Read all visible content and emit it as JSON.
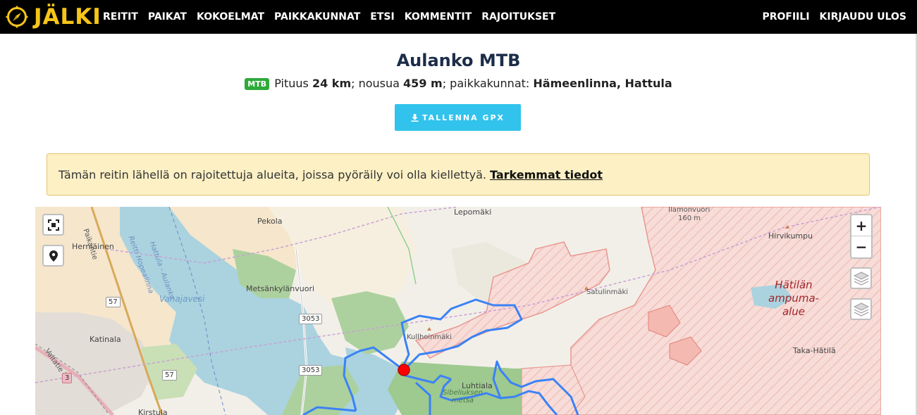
{
  "navbar": {
    "brand": "JÄLKI",
    "left_links": [
      "REITIT",
      "PAIKAT",
      "KOKOELMAT",
      "PAIKKAKUNNAT",
      "ETSI",
      "KOMMENTIT",
      "RAJOITUKSET"
    ],
    "right_links": [
      "PROFIILI",
      "KIRJAUDU ULOS"
    ],
    "colors": {
      "background": "#000000",
      "brand": "#f5c518",
      "link": "#ffffff"
    }
  },
  "route": {
    "title": "Aulanko MTB",
    "badge": "MTB",
    "length_label": "Pituus",
    "length_value": "24 km",
    "ascent_label": "; nousua",
    "ascent_value": "459 m",
    "places_label": "; paikkakunnat:",
    "places_value": "Hämeenlinna, Hattula"
  },
  "gpx_button": {
    "label": "TALLENNA GPX",
    "icon": "download-icon",
    "color": "#31c3ec"
  },
  "alert": {
    "text": "Tämän reitin lähellä on rajoitettuja alueita, joissa pyöräily voi olla kiellettyä.",
    "link_text": "Tarkemmat tiedot",
    "background": "#fcf0c4"
  },
  "map": {
    "controls": {
      "fullscreen_icon": "fullscreen-icon",
      "locate_icon": "location-pin-icon",
      "zoom_in": "+",
      "zoom_out": "−",
      "layers_icon": "layers-icon"
    },
    "labels": {
      "lepomaki": "Lepomäki",
      "ilamonvuori": "Ilamonvuori",
      "ilamonvuori_elev": "160 m",
      "hirvikumpu": "Hirvikumpu",
      "pekola": "Pekola",
      "herniainen": "Herniäinen",
      "metsankylanvuori": "Metsänkylänvuori",
      "vanajavesi": "Vanajavesi",
      "satulinmaki": "Satulinmäki",
      "hatilan_ampuma_alue_1": "Hätilän",
      "hatilan_ampuma_alue_2": "ampuma-",
      "hatilan_ampuma_alue_3": "alue",
      "kullhoinmaki": "Kullhoinmäki",
      "katinala": "Katinala",
      "taka_hatila": "Taka-Hätilä",
      "luhtiala": "Luhtiala",
      "sibeliuksen_metsa_1": "Sibeliuksen",
      "sibeliuksen_metsa_2": "metsä",
      "kirstula": "Kirstula",
      "reitti_hopealinna": "Reitti Hopealinna",
      "hattula_aulanko": "Hattula - Aulanko",
      "paikantie": "Paikantie",
      "valtatie_3": "Valtatie 3"
    },
    "road_shields": [
      "57",
      "3053",
      "3053",
      "57",
      "3"
    ],
    "colors": {
      "route": "#3b82f6",
      "restricted_area": "#f2a0a0",
      "forest": "#a8d39c",
      "water": "#aad3df",
      "start_marker": "#ff0000"
    }
  }
}
